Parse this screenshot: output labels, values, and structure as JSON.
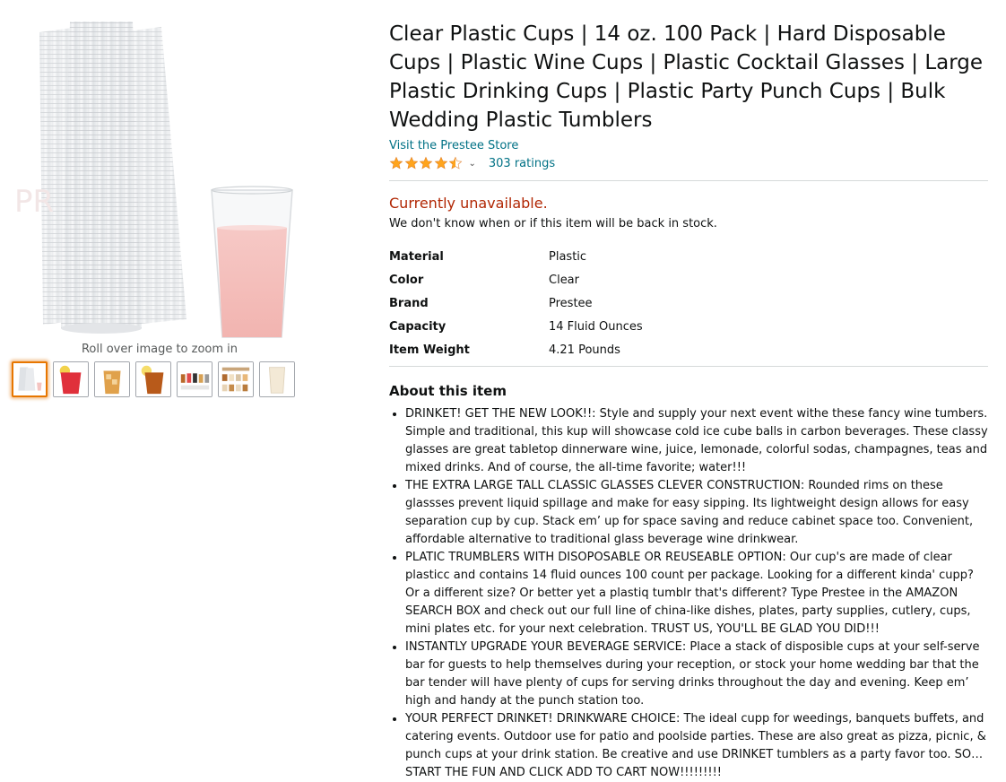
{
  "gallery": {
    "zoom_hint": "Roll over image to zoom in",
    "thumbnails": [
      "stack-of-cups",
      "red-drink-cup",
      "iced-tea-cup",
      "iced-tea-lemon-cup",
      "size-chart",
      "cups-comparison-chart",
      "single-clear-cup"
    ]
  },
  "product": {
    "title": "Clear Plastic Cups | 14 oz. 100 Pack | Hard Disposable Cups | Plastic Wine Cups | Plastic Cocktail Glasses | Large Plastic Drinking Cups | Plastic Party Punch Cups | Bulk Wedding Plastic Tumblers",
    "store_link": "Visit the Prestee Store",
    "rating": 4.5,
    "ratings_count": "303 ratings",
    "availability": "Currently unavailable.",
    "availability_note": "We don't know when or if this item will be back in stock.",
    "specs": [
      {
        "key": "Material",
        "value": "Plastic"
      },
      {
        "key": "Color",
        "value": "Clear"
      },
      {
        "key": "Brand",
        "value": "Prestee"
      },
      {
        "key": "Capacity",
        "value": "14 Fluid Ounces"
      },
      {
        "key": "Item Weight",
        "value": "4.21 Pounds"
      }
    ],
    "about_heading": "About this item",
    "bullets": [
      "DRINKET! GET THE NEW LOOK!!: Style and supply your next event withe these fancy wine tumbers. Simple and traditional, this kup will showcase cold ice cube balls in carbon beverages. These classy glasses are great tabletop dinnerware wine, juice, lemonade, colorful sodas, champagnes, teas and mixed drinks. And of course, the all-time favorite; water!!!",
      "THE EXTRA LARGE TALL CLASSIC GLASSES CLEVER CONSTRUCTION: Rounded rims on these glassses prevent liquid spillage and make for easy sipping. Its lightweight design allows for easy separation cup by cup. Stack em’ up for space saving and reduce cabinet space too. Convenient, affordable alternative to traditional glass beverage wine drinkwear.",
      "PLATIC TRUMBLERS WITH DISOPOSABLE OR REUSEABLE OPTION: Our cup's are made of clear plasticc and contains 14 fluid ounces 100 count per package. Looking for a different kinda' cupp? Or a different size? Or better yet a plastiq tumblr that's different? Type Prestee in the AMAZON SEARCH BOX and check out our full line of china-like dishes, plates, party supplies, cutlery, cups, mini plates etc. for your next celebration. TRUST US, YOU'LL BE GLAD YOU DID!!!",
      "INSTANTLY UPGRADE YOUR BEVERAGE SERVICE: Place a stack of disposible cups at your self-serve bar for guests to help themselves during your reception, or stock your home wedding bar that the bar tender will have plenty of cups for serving drinks throughout the day and evening. Keep em’ high and handy at the punch station too.",
      "YOUR PERFECT DRINKET! DRINKWARE CHOICE: The ideal cupp for weedings, banquets buffets, and catering events. Outdoor use for patio and poolside parties. These are also great as pizza, picnic, & punch cups at your drink station. Be creative and use DRINKET tumblers as a party favor too. SO… START THE FUN AND CLICK ADD TO CART NOW!!!!!!!!!"
    ]
  },
  "colors": {
    "link": "#007185",
    "unavailable": "#b12704",
    "star": "#ffa41c",
    "thumb_active": "#e77600"
  }
}
